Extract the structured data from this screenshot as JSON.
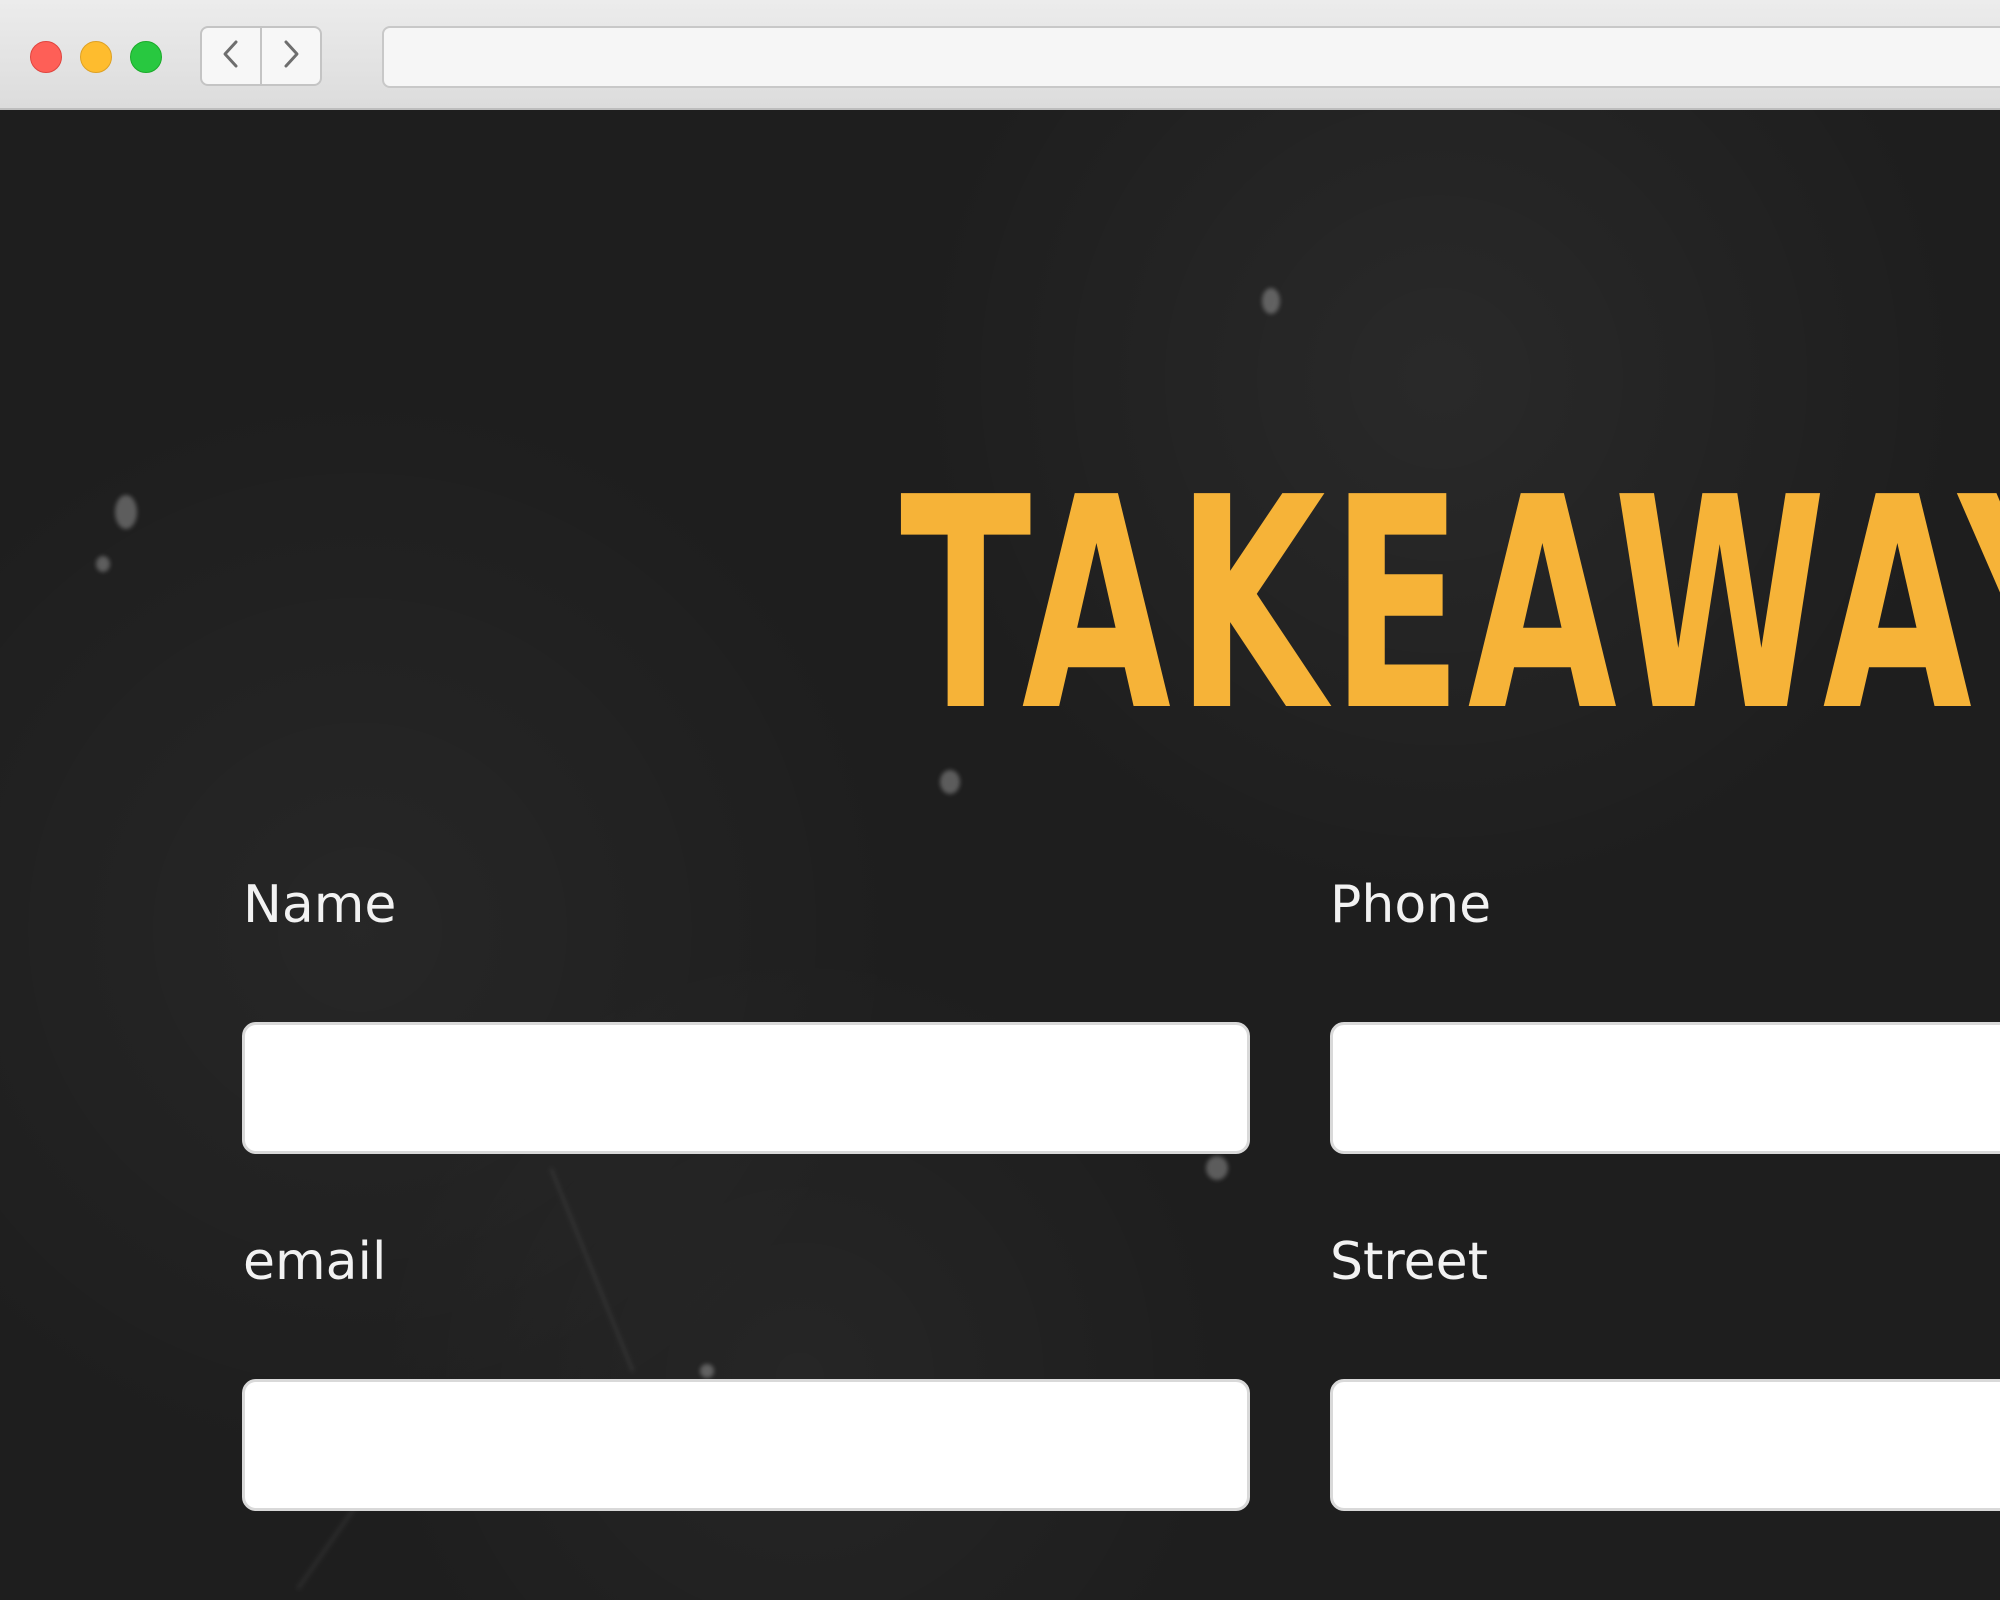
{
  "browser": {
    "address": "",
    "nav": {
      "back_icon": "chevron-left-icon",
      "forward_icon": "chevron-right-icon"
    }
  },
  "page": {
    "title": "TAKEAWAY",
    "accent_color": "#f6b338",
    "form": {
      "fields": [
        {
          "label": "Name",
          "value": ""
        },
        {
          "label": "Phone",
          "value": ""
        },
        {
          "label": "email",
          "value": ""
        },
        {
          "label": "Street",
          "value": ""
        }
      ]
    }
  }
}
